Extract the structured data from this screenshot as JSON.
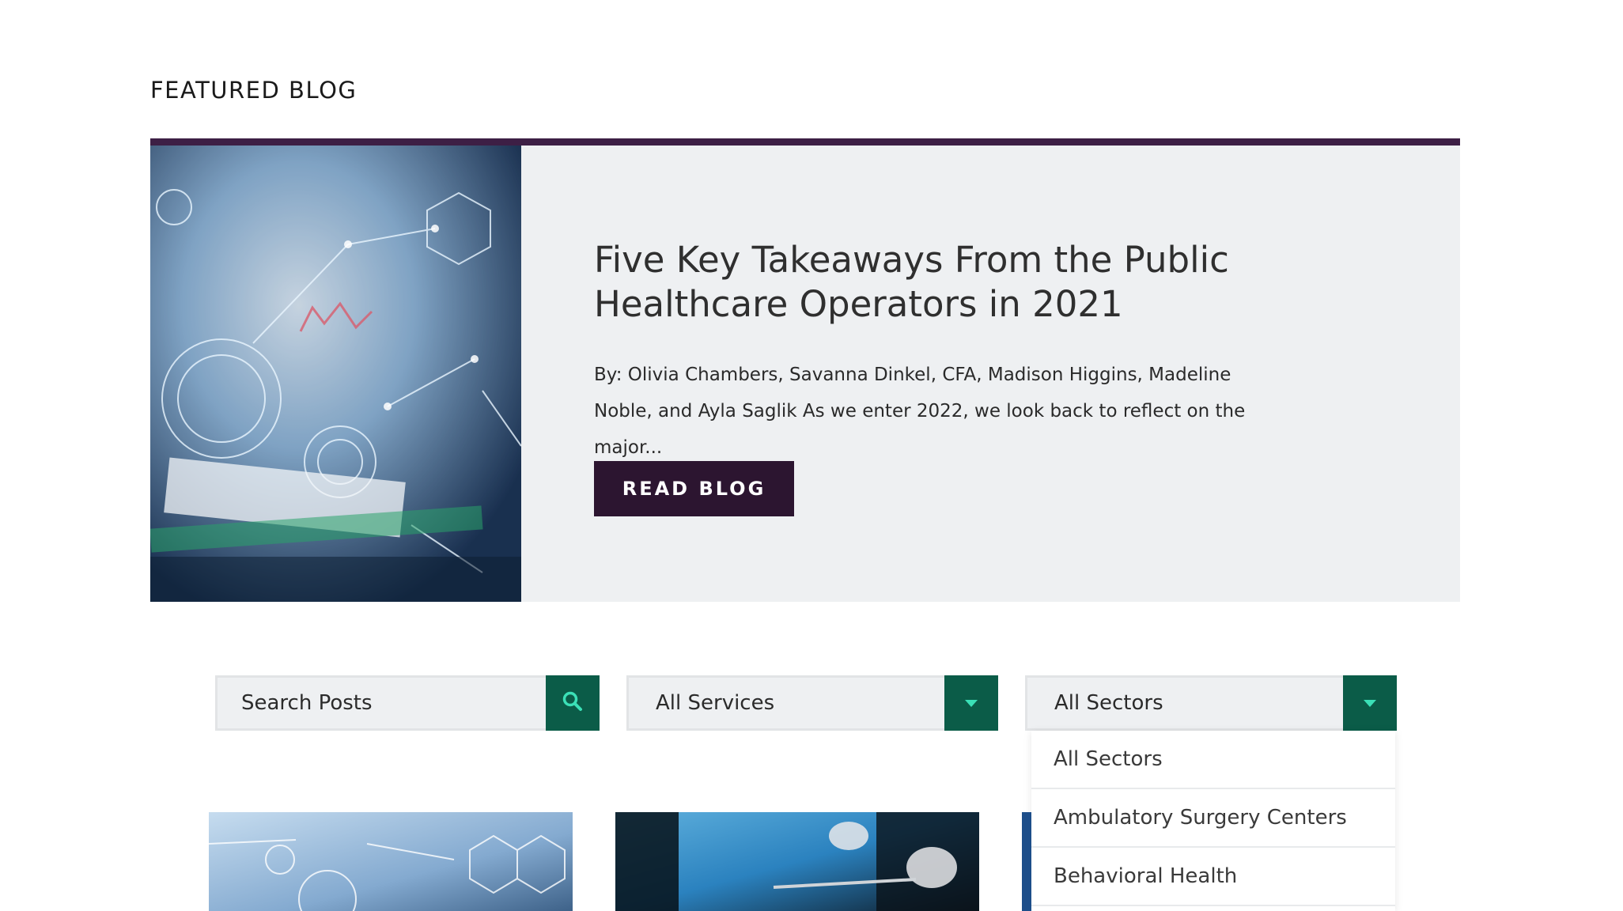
{
  "section": {
    "title": "FEATURED BLOG"
  },
  "featured": {
    "title": "Five Key Takeaways From the Public Healthcare Operators in 2021",
    "excerpt": "By: Olivia Chambers, Savanna Dinkel, CFA, Madison Higgins, Madeline Noble, and Ayla Saglik As we enter 2022, we look back to reflect on the major...",
    "button_label": "READ BLOG",
    "image_icon": "healthcare-digital-image"
  },
  "filters": {
    "search_placeholder": "Search Posts",
    "services_selected": "All Services",
    "sectors_selected": "All Sectors",
    "search_icon": "search-icon",
    "dropdown_icon": "caret-down-icon"
  },
  "sectors_dropdown": {
    "options": [
      "All Sectors",
      "Ambulatory Surgery Centers",
      "Behavioral Health"
    ]
  },
  "colors": {
    "accent_purple": "#3d1f45",
    "button_dark": "#2c1530",
    "filter_green": "#0b5c48",
    "card_bg": "#eef0f2"
  }
}
